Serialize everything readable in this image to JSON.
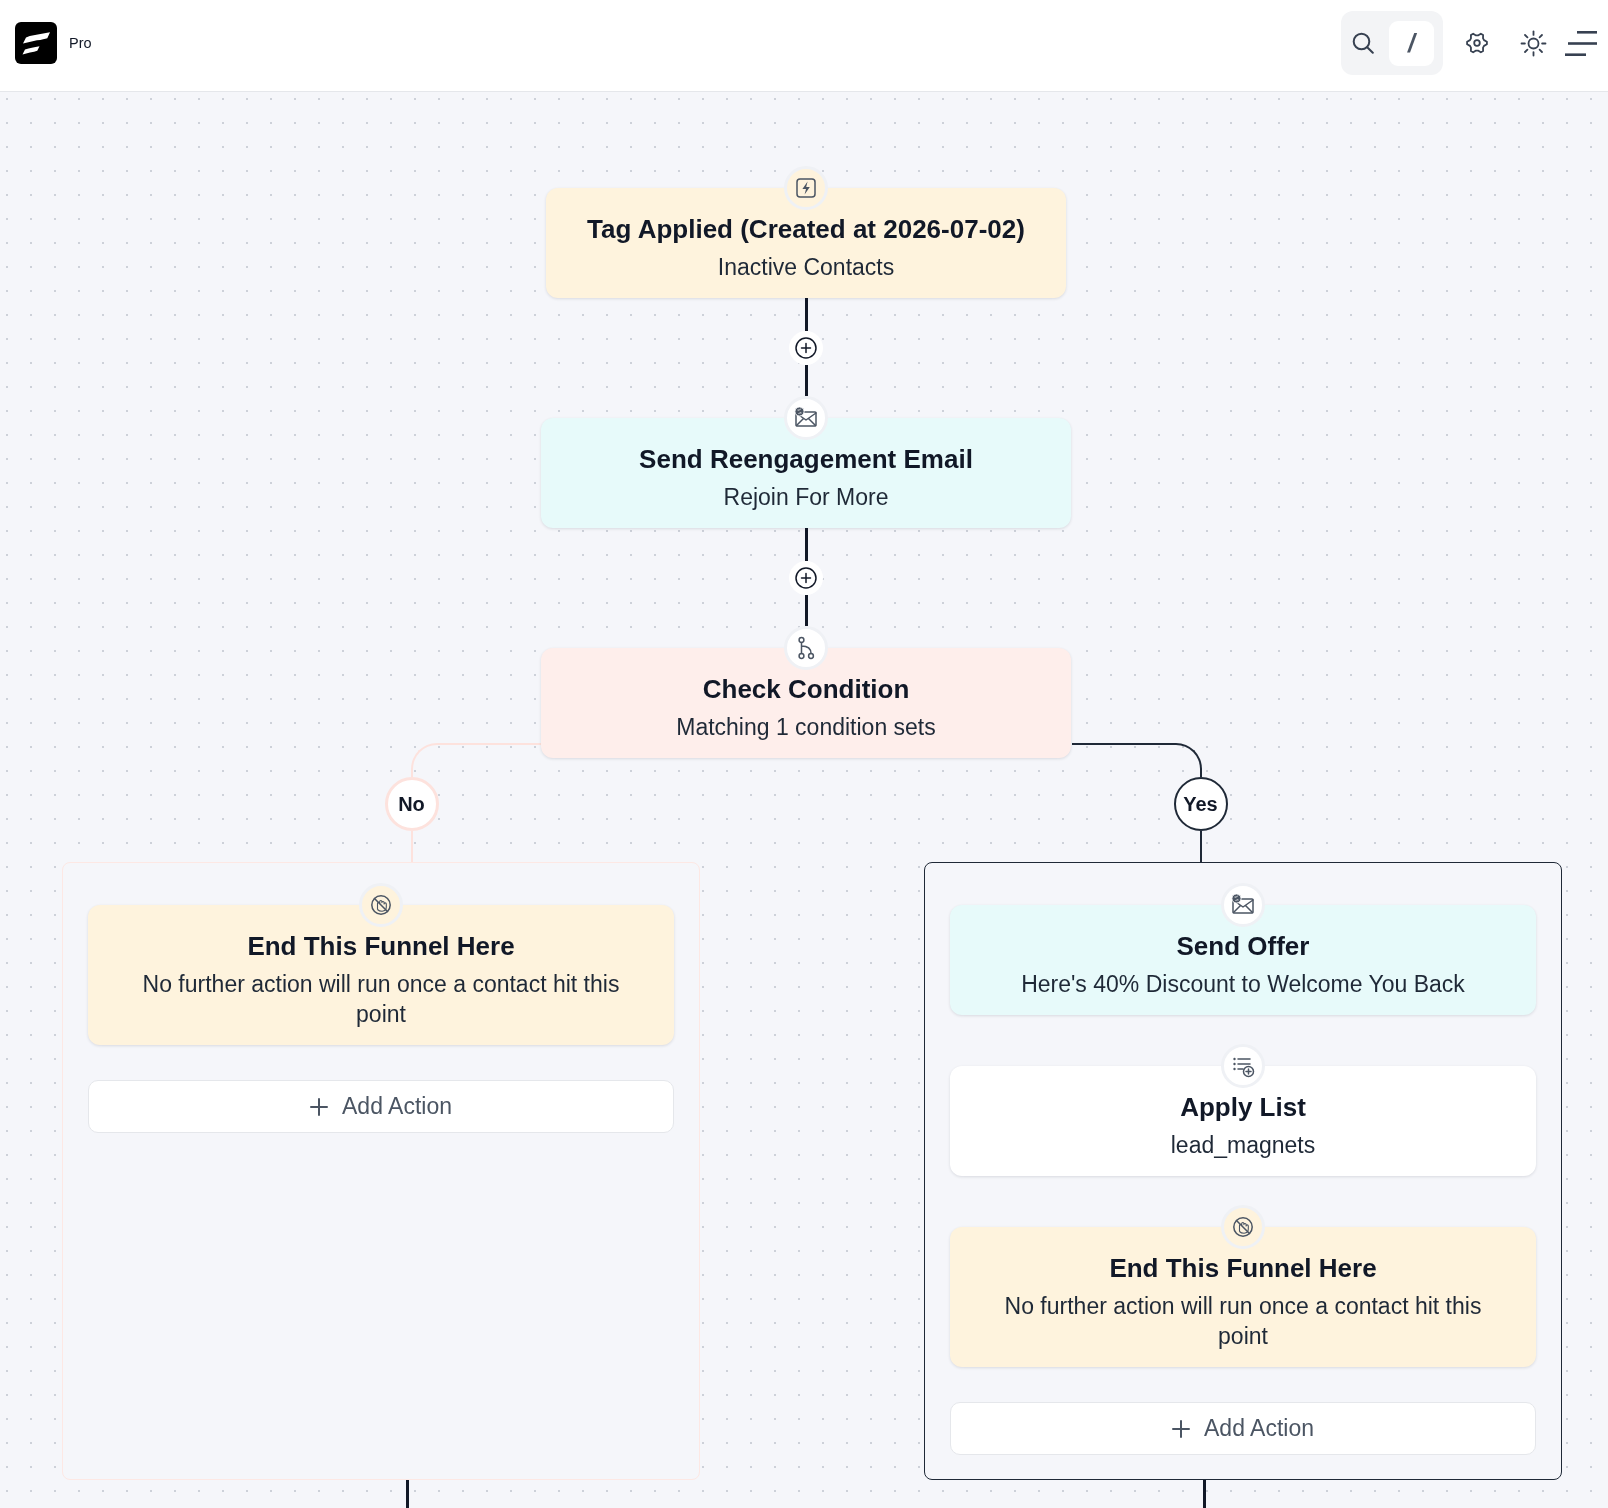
{
  "header": {
    "plan": "Pro",
    "search_shortcut": "/"
  },
  "flow": {
    "steps": [
      {
        "kind": "trigger",
        "title": "Tag Applied (Created at 2026-07-02)",
        "subtitle": "Inactive Contacts"
      },
      {
        "kind": "email",
        "title": "Send Reengagement Email",
        "subtitle": "Rejoin For More"
      },
      {
        "kind": "condition",
        "title": "Check Condition",
        "subtitle": "Matching 1 condition sets",
        "branches": [
          {
            "label": "No",
            "selected": false,
            "steps": [
              {
                "kind": "end",
                "title": "End This Funnel Here",
                "subtitle": "No further action will run once a contact hit this point"
              }
            ],
            "add_button": "Add Action"
          },
          {
            "label": "Yes",
            "selected": true,
            "steps": [
              {
                "kind": "email",
                "title": "Send Offer",
                "subtitle": "Here's 40% Discount to Welcome You Back"
              },
              {
                "kind": "list",
                "title": "Apply List",
                "subtitle": "lead_magnets"
              },
              {
                "kind": "end",
                "title": "End This Funnel Here",
                "subtitle": "No further action will run once a contact hit this point"
              }
            ],
            "add_button": "Add Action"
          }
        ]
      }
    ]
  }
}
